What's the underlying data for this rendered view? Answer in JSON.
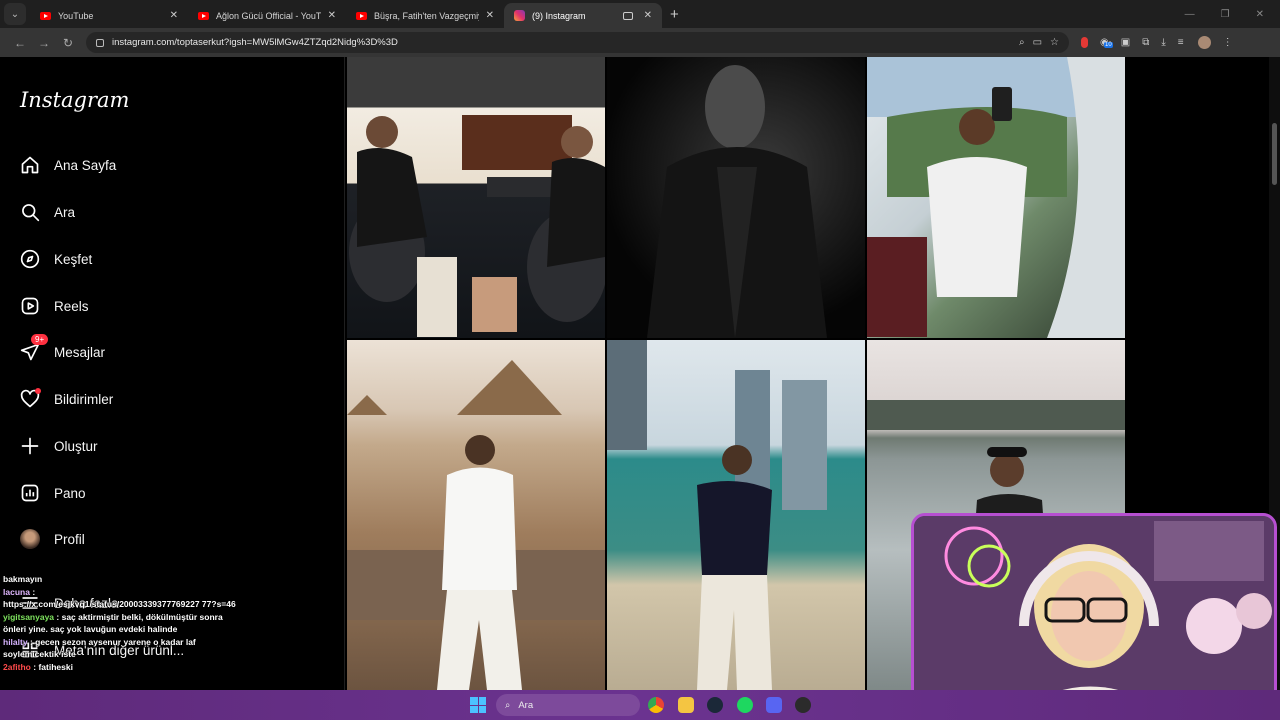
{
  "browser": {
    "tabs": [
      {
        "label": "YouTube",
        "favicon": "youtube-icon",
        "active": false
      },
      {
        "label": "Ağlon Gücü Official - YouTube",
        "favicon": "youtube-icon",
        "active": false
      },
      {
        "label": "Büşra, Fatih'ten Vazgeçmiyor O",
        "favicon": "youtube-icon",
        "active": false
      },
      {
        "label": "(9) Instagram",
        "favicon": "instagram-icon",
        "active": true
      }
    ],
    "url": "instagram.com/toptaserkut?igsh=MW5lMGw4ZTZqd2Nidg%3D%3D",
    "extension_badge": "10"
  },
  "instagram": {
    "logo": "Instagram",
    "nav": [
      {
        "label": "Ana Sayfa",
        "icon": "home-icon"
      },
      {
        "label": "Ara",
        "icon": "search-icon"
      },
      {
        "label": "Keşfet",
        "icon": "compass-icon"
      },
      {
        "label": "Reels",
        "icon": "reels-icon"
      },
      {
        "label": "Mesajlar",
        "icon": "messenger-icon",
        "badge": "9+"
      },
      {
        "label": "Bildirimler",
        "icon": "heart-icon"
      },
      {
        "label": "Oluştur",
        "icon": "plus-icon"
      },
      {
        "label": "Pano",
        "icon": "dashboard-icon"
      },
      {
        "label": "Profil",
        "icon": "profile-avatar"
      }
    ],
    "more_label": "Daha fazla",
    "meta_label": "Meta'nın diğer ürünl..."
  },
  "chat": [
    {
      "user": "",
      "text": "bakmayın"
    },
    {
      "user": "lacuna",
      "text": ":"
    },
    {
      "user": "",
      "text": "https://x.com/esjkvq1/status/20003339377769227 77?s=46"
    },
    {
      "user": "yigitsanyaya",
      "text": ": saç aktirmiştir belki, dökülmüştür sonra önleri yine. saç yok lavuğun evdeki halinde"
    },
    {
      "user": "hilalty",
      "text": ": gecen sezon aysenur yarene o kadar laf soylemicektik iste"
    },
    {
      "user": "2afitho",
      "text": ": fatiheski"
    }
  ],
  "taskbar": {
    "search_placeholder": "Ara"
  },
  "colors": {
    "badge_red": "#ff3040",
    "webcam_border": "#b64fd1",
    "taskbar": "#6b3390"
  }
}
